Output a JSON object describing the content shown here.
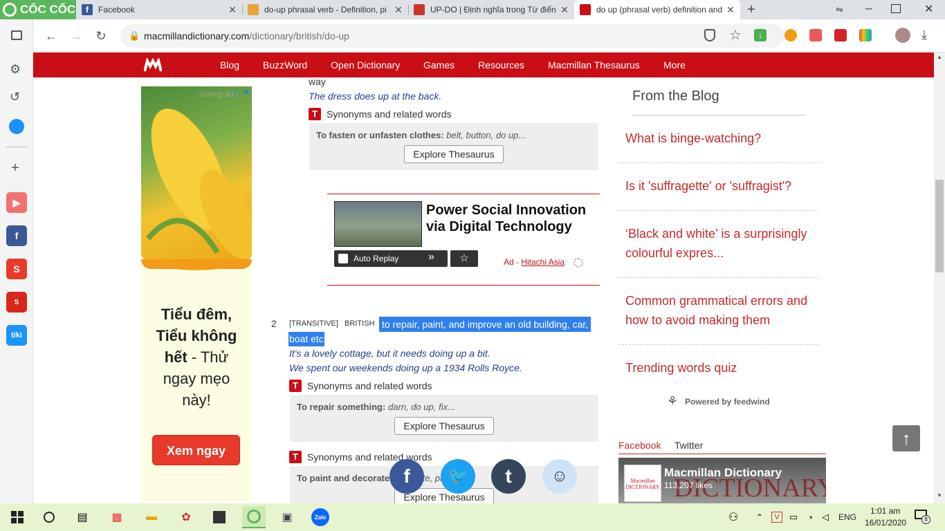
{
  "browser": {
    "brand": "CỐC CỐC",
    "tabs": [
      {
        "title": "Facebook"
      },
      {
        "title": "do-up phrasal verb - Definition, pi"
      },
      {
        "title": "UP-DO | Định nghĩa trong Từ điển"
      },
      {
        "title": "do up (phrasal verb) definition and"
      }
    ],
    "url_host": "macmillandictionary.com",
    "url_path": "/dictionary/british/do-up"
  },
  "nav": {
    "items": [
      "Blog",
      "BuzzWord",
      "Open Dictionary",
      "Games",
      "Resources",
      "Macmillan Thesaurus",
      "More"
    ]
  },
  "left_ad": {
    "watermark": "Vương Bảo",
    "headline_bold": "Tiểu đêm, Tiểu không hết",
    "headline_rest": " - Thử ngay mẹo này!",
    "cta": "Xem ngay"
  },
  "entry": {
    "prev_tail": "way",
    "prev_example": "The dress does up at the back.",
    "synonyms_label": "Synonyms and related words",
    "thesaurus_button": "Explore Thesaurus",
    "box1": {
      "head": "To fasten or unfasten clothes:",
      "words": "belt, button, do up..."
    },
    "video_ad": {
      "title": "Power Social Innovation via Digital Technology",
      "auto_replay": "Auto Replay",
      "ad_prefix": "Ad - ",
      "advertiser": "Hitachi Asia"
    },
    "sense2": {
      "number": "2",
      "grammar": "[TRANSITIVE]",
      "region": "BRITISH",
      "definition_line1": "to repair, paint, and improve an old building, car,",
      "definition_line2": "boat etc",
      "example1": "It's a lovely cottage, but it needs doing up a bit.",
      "example2": "We spent our weekends doing up a 1934 Rolls Royce."
    },
    "box2": {
      "head": "To repair something:",
      "words": "darn, do up, fix..."
    },
    "box3": {
      "head": "To paint and decorate:",
      "words": "decorate, paper..."
    }
  },
  "blog": {
    "heading": "From the Blog",
    "items": [
      "What is binge-watching?",
      "Is it 'suffragette' or 'suffragist'?",
      "‘Black and white’ is a surprisingly colourful expres...",
      "Common grammatical errors and how to avoid making them",
      "Trending words quiz"
    ],
    "powered_by": "Powered by feedwind"
  },
  "social_tabs": [
    "Facebook",
    "Twitter"
  ],
  "fb_widget": {
    "name": "Macmillan Dictionary",
    "likes": "113,207 likes",
    "bg_word": "DICTIONARY",
    "logo_word": "Macmillan DICTIONARY"
  },
  "taskbar": {
    "lang": "ENG",
    "time": "1:01 am",
    "date": "16/01/2020",
    "notif_count": "8",
    "zalo": "Zalo"
  },
  "colors": {
    "brand_red": "#c90f15",
    "highlight": "#2f80ed",
    "link_red": "#c62a2a",
    "taskbar": "#e6f4d0"
  }
}
